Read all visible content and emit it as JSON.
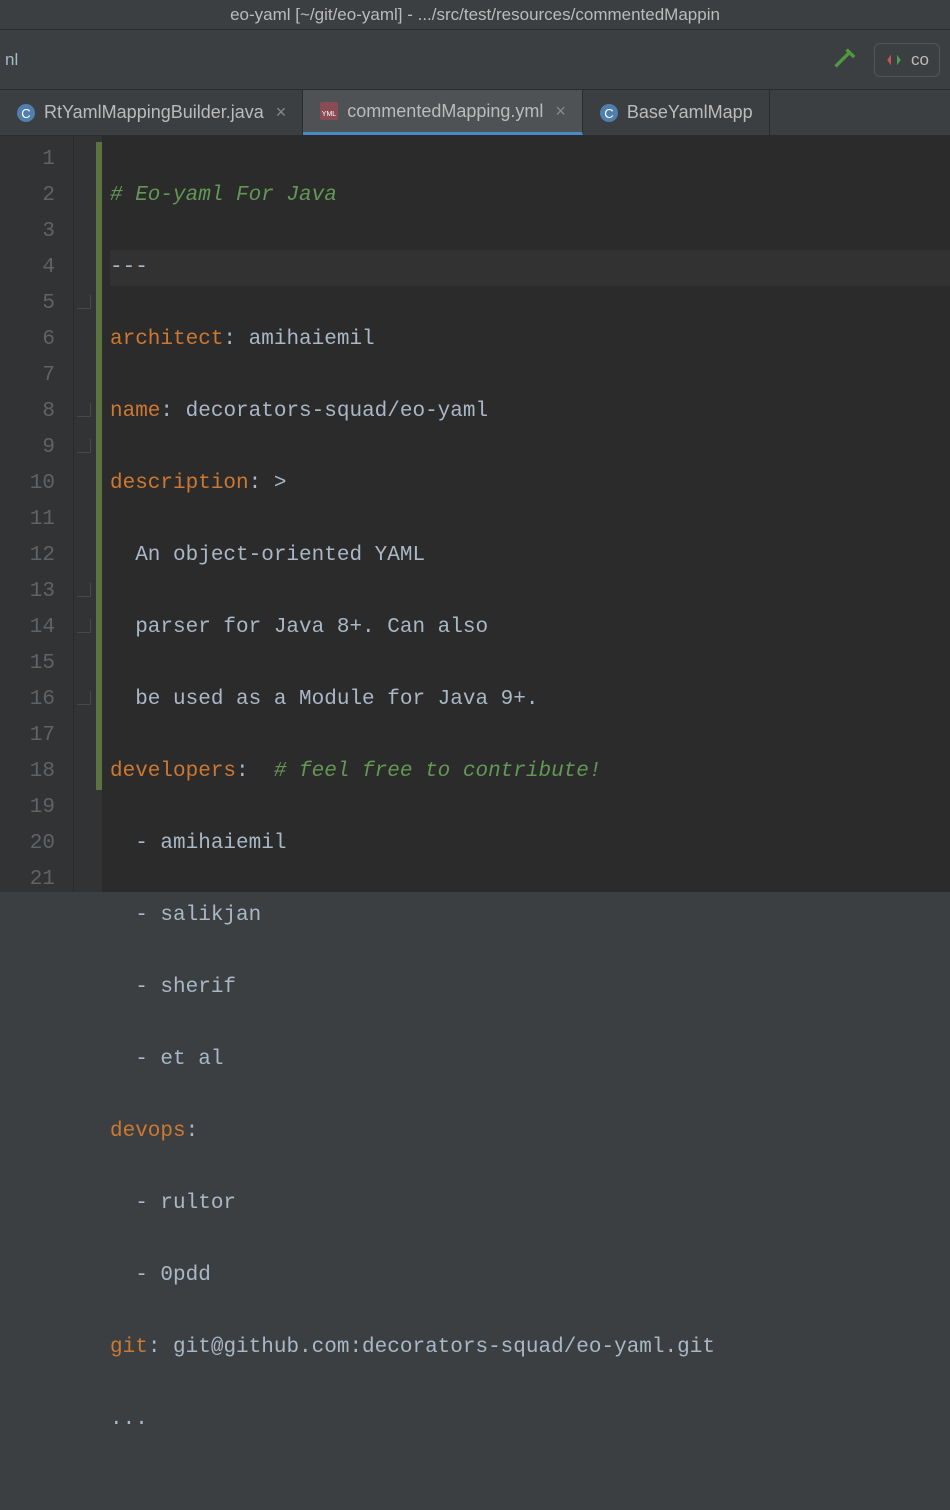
{
  "title": "eo-yaml [~/git/eo-yaml] - .../src/test/resources/commentedMappin",
  "breadcrumb_fragment": "nl",
  "search_fragment": "co",
  "tabs": [
    {
      "label": "RtYamlMappingBuilder.java",
      "icon": "java",
      "active": false,
      "closable": true
    },
    {
      "label": "commentedMapping.yml",
      "icon": "yml",
      "active": true,
      "closable": true
    },
    {
      "label": "BaseYamlMapp",
      "icon": "java",
      "active": false,
      "closable": false
    }
  ],
  "gutter_lines": [
    "1",
    "2",
    "3",
    "4",
    "5",
    "6",
    "7",
    "8",
    "9",
    "10",
    "11",
    "12",
    "13",
    "14",
    "15",
    "16",
    "17",
    "18",
    "19",
    "20",
    "21"
  ],
  "code": {
    "l1_comment": "# Eo-yaml For Java",
    "l2": "---",
    "l3_key": "architect",
    "l3_sep": ": ",
    "l3_val": "amihaiemil",
    "l4_key": "name",
    "l4_sep": ": ",
    "l4_val": "decorators-squad/eo-yaml",
    "l5_key": "description",
    "l5_sep": ": ",
    "l5_val": ">",
    "l6": "  An object-oriented YAML",
    "l7": "  parser for Java 8+. Can also",
    "l8": "  be used as a Module for Java 9+.",
    "l9_key": "developers",
    "l9_sep": ":  ",
    "l9_comment": "# feel free to contribute!",
    "l10": "  - amihaiemil",
    "l11": "  - salikjan",
    "l12": "  - sherif",
    "l13": "  - et al",
    "l14_key": "devops",
    "l14_sep": ":",
    "l15": "  - rultor",
    "l16": "  - 0pdd",
    "l17_key": "git",
    "l17_sep": ": ",
    "l17_val": "git@github.com:decorators-squad/eo-yaml.git",
    "l18": "..."
  }
}
